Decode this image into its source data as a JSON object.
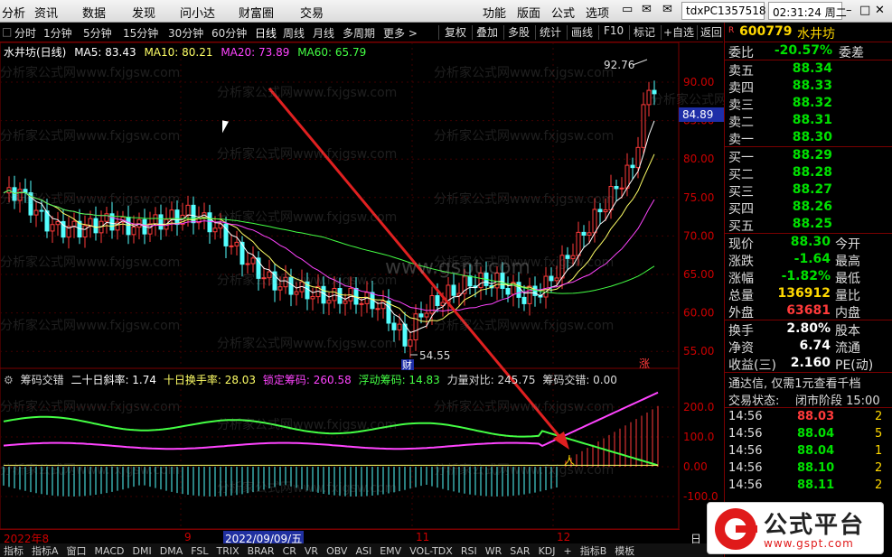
{
  "menu": {
    "left": [
      "分析",
      "资讯",
      "数据",
      "发现",
      "问小达",
      "财富圈",
      "交易"
    ],
    "right": [
      "功能",
      "版面",
      "公式",
      "选项"
    ],
    "account": "tdxPC1357518",
    "clock": "02:31:24 周二"
  },
  "toolbar": {
    "periods": [
      "分时",
      "1分钟",
      "5分钟",
      "15分钟",
      "30分钟",
      "60分钟",
      "日线",
      "周线",
      "月线",
      "多周期",
      "更多 >"
    ],
    "active_period": "日线",
    "tools": [
      "复权",
      "叠加",
      "多股",
      "统计",
      "画线",
      "F10",
      "标记",
      "+自选",
      "返回"
    ]
  },
  "ma_legend": {
    "name": "水井坊(日线)",
    "items": [
      {
        "label": "MA5: 83.43",
        "color": "#ffffff"
      },
      {
        "label": "MA10: 80.21",
        "color": "#ffff66"
      },
      {
        "label": "MA20: 73.89",
        "color": "#ff44ff"
      },
      {
        "label": "MA60: 65.79",
        "color": "#44ff44"
      }
    ]
  },
  "price_axis": {
    "labels": [
      "90.00",
      "85.00",
      "80.00",
      "75.00",
      "70.00",
      "65.00",
      "60.00",
      "55.00"
    ],
    "current": "84.89"
  },
  "chart_annotations": {
    "high_label": "92.76",
    "low_label": "54.55",
    "cai_badge": "财",
    "zhang_badge": "涨",
    "dot_label": "人"
  },
  "indicator": {
    "items": [
      {
        "label": "筹码交错",
        "color": "#dddddd"
      },
      {
        "label": "二十日斜率: 1.74",
        "color": "#ffffff"
      },
      {
        "label": "十日换手率: 28.03",
        "color": "#ffff66"
      },
      {
        "label": "锁定筹码: 260.58",
        "color": "#ff44ff"
      },
      {
        "label": "浮动筹码: 14.83",
        "color": "#44ff44"
      },
      {
        "label": "力量对比: 245.75",
        "color": "#dddddd"
      },
      {
        "label": "筹码交错: 0.00",
        "color": "#dddddd"
      }
    ],
    "axis": [
      "200.0",
      "100.0",
      "0.00",
      "-100.0"
    ]
  },
  "date_axis": {
    "labels": [
      "2022年8",
      "9",
      "11",
      "12"
    ],
    "selected": "2022/09/09/五",
    "end": "日"
  },
  "bottom_tabs": [
    "指标",
    "指标A",
    "窗口",
    "MACD",
    "DMI",
    "DMA",
    "FSL",
    "TRIX",
    "BRAR",
    "CR",
    "VR",
    "OBV",
    "ASI",
    "EMV",
    "VOL-TDX",
    "RSI",
    "WR",
    "SAR",
    "KDJ",
    "+",
    "指标B",
    "模板"
  ],
  "quote": {
    "code": "600779",
    "name": "水井坊",
    "r_mark": "R",
    "weibi_label": "委比",
    "weibi_value": "-20.57%",
    "weicha_label": "委差",
    "sell": [
      {
        "label": "卖五",
        "price": "88.34"
      },
      {
        "label": "卖四",
        "price": "88.33"
      },
      {
        "label": "卖三",
        "price": "88.32"
      },
      {
        "label": "卖二",
        "price": "88.31"
      },
      {
        "label": "卖一",
        "price": "88.30"
      }
    ],
    "buy": [
      {
        "label": "买一",
        "price": "88.29"
      },
      {
        "label": "买二",
        "price": "88.28"
      },
      {
        "label": "买三",
        "price": "88.27"
      },
      {
        "label": "买四",
        "price": "88.26"
      },
      {
        "label": "买五",
        "price": "88.25"
      }
    ],
    "stats": [
      {
        "label": "现价",
        "value": "88.30",
        "extra": "今开",
        "color": "grn"
      },
      {
        "label": "涨跌",
        "value": "-1.64",
        "extra": "最高",
        "color": "grn"
      },
      {
        "label": "涨幅",
        "value": "-1.82%",
        "extra": "最低",
        "color": "grn"
      },
      {
        "label": "总量",
        "value": "136912",
        "extra": "量比",
        "color": "yel"
      },
      {
        "label": "外盘",
        "value": "63681",
        "extra": "内盘",
        "color": "red"
      }
    ],
    "stats2": [
      {
        "label": "换手",
        "value": "2.80%",
        "extra": "股本",
        "color": "wht"
      },
      {
        "label": "净资",
        "value": "6.74",
        "extra": "流通",
        "color": "wht"
      },
      {
        "label": "收益(三)",
        "value": "2.160",
        "extra": "PE(动)",
        "color": "wht"
      }
    ],
    "notice": "通达信, 仅需1元查看千档",
    "trade_status_label": "交易状态:",
    "trade_status_value": "闭市阶段 15:00",
    "ticks": [
      {
        "time": "14:56",
        "price": "88.03",
        "vol": "2",
        "color": "red"
      },
      {
        "time": "14:56",
        "price": "88.04",
        "vol": "5",
        "color": "grn"
      },
      {
        "time": "14:56",
        "price": "88.04",
        "vol": "1",
        "color": "grn"
      },
      {
        "time": "14:56",
        "price": "88.10",
        "vol": "2",
        "color": "grn"
      },
      {
        "time": "14:56",
        "price": "88.11",
        "vol": "2",
        "color": "grn"
      }
    ]
  },
  "watermark": {
    "main": "分析家公式网www.fxjgsw.com",
    "site": "www.gspt.com"
  },
  "logo": {
    "title": "公式平台",
    "url": "www.gspt.com"
  }
}
